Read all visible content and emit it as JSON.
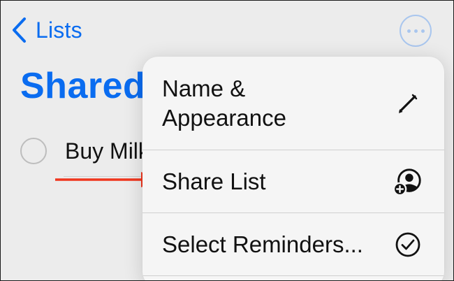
{
  "nav": {
    "back_label": "Lists",
    "more_icon": "ellipsis-circle-icon"
  },
  "list": {
    "title": "Shared"
  },
  "reminders": [
    {
      "text": "Buy Milk",
      "completed": false
    }
  ],
  "menu": {
    "items": [
      {
        "label": "Name & Appearance",
        "icon": "pencil-icon"
      },
      {
        "label": "Share List",
        "icon": "person-add-icon"
      },
      {
        "label": "Select Reminders...",
        "icon": "checkmark-circle-icon"
      }
    ]
  },
  "colors": {
    "accent": "#0a6cf0",
    "annotation_arrow": "#f0361e",
    "menu_bg": "#f5f5f5",
    "page_bg": "#ececec"
  }
}
